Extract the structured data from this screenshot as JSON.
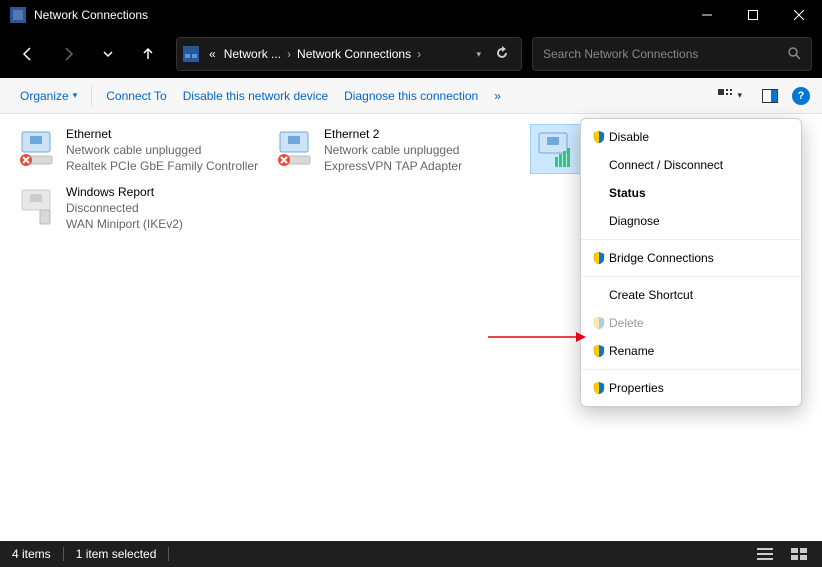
{
  "window": {
    "title": "Network Connections"
  },
  "nav": {
    "path_prefix": "«",
    "seg1": "Network ...",
    "seg2": "Network Connections"
  },
  "search": {
    "placeholder": "Search Network Connections"
  },
  "toolbar": {
    "organize": "Organize",
    "connect_to": "Connect To",
    "disable": "Disable this network device",
    "diagnose": "Diagnose this connection",
    "more": "»"
  },
  "items": [
    {
      "name": "Ethernet",
      "line2": "Network cable unplugged",
      "line3": "Realtek PCIe GbE Family Controller",
      "state": "unplugged"
    },
    {
      "name": "Ethernet 2",
      "line2": "Network cable unplugged",
      "line3": "ExpressVPN TAP Adapter",
      "state": "unplugged"
    },
    {
      "name": "",
      "line2": "",
      "line3": "",
      "state": "connected",
      "selected": true
    },
    {
      "name": "Windows Report",
      "line2": "Disconnected",
      "line3": "WAN Miniport (IKEv2)",
      "state": "disconnected"
    }
  ],
  "context_menu": {
    "disable": "Disable",
    "connect_disconnect": "Connect / Disconnect",
    "status": "Status",
    "diagnose": "Diagnose",
    "bridge": "Bridge Connections",
    "shortcut": "Create Shortcut",
    "delete": "Delete",
    "rename": "Rename",
    "properties": "Properties"
  },
  "status": {
    "count": "4 items",
    "selected": "1 item selected"
  }
}
